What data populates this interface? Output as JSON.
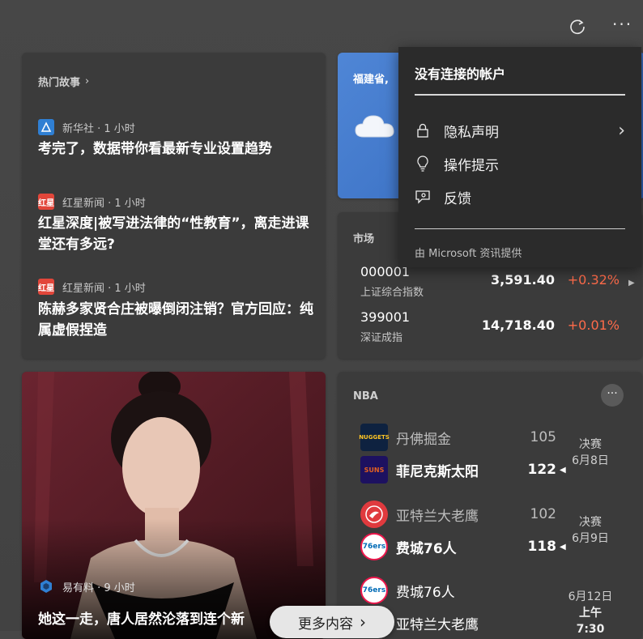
{
  "hot": {
    "title": "热门故事",
    "items": [
      {
        "source": "新华社 · 1 小时",
        "headline": "考完了，数据带你看最新专业设置趋势"
      },
      {
        "source": "红星新闻 · 1 小时",
        "headline": "红星深度|被写进法律的“性教育”，离走进课堂还有多远?"
      },
      {
        "source": "红星新闻 · 1 小时",
        "headline": "陈赫多家贤合庄被曝倒闭注销？官方回应：纯属虚假捏造"
      }
    ],
    "logo_text": "红星"
  },
  "weather": {
    "location": "福建省,"
  },
  "market": {
    "title": "市场",
    "rows": [
      {
        "code": "000001",
        "name": "上证综合指数",
        "value": "3,591.40",
        "change": "+0.32%"
      },
      {
        "code": "399001",
        "name": "深证成指",
        "value": "14,718.40",
        "change": "+0.01%"
      }
    ]
  },
  "photo_story": {
    "source": "易有料 · 9 小时",
    "headline": "她这一走，唐人居然沦落到连个新"
  },
  "nba": {
    "title": "NBA",
    "games": [
      {
        "team1": "丹佛掘金",
        "score1": "105",
        "team2": "菲尼克斯太阳",
        "score2": "122",
        "status": "决赛",
        "date": "6月8日"
      },
      {
        "team1": "亚特兰大老鹰",
        "score1": "102",
        "team2": "费城76人",
        "score2": "118",
        "status": "决赛",
        "date": "6月9日"
      },
      {
        "team1": "费城76人",
        "team2": "亚特兰大老鹰",
        "date": "6月12日",
        "time": "上午7:30"
      }
    ],
    "logos": {
      "nuggets": "NUGGETS",
      "suns": "SUNS",
      "sixers": "76ers"
    }
  },
  "menu": {
    "title": "没有连接的帐户",
    "items": [
      "隐私声明",
      "操作提示",
      "反馈"
    ],
    "footer": "由 Microsoft 资讯提供"
  },
  "more_button": "更多内容",
  "colors": {
    "accent_red": "#ff6b4a",
    "weather_blue": "#3a70c4"
  }
}
